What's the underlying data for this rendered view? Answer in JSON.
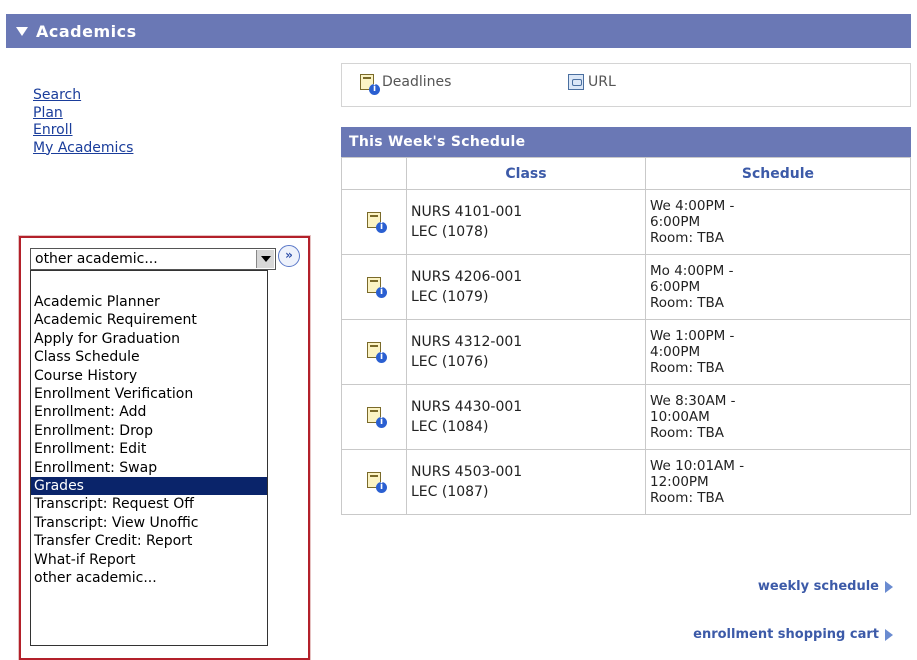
{
  "header": {
    "title": "Academics"
  },
  "links": [
    "Search",
    "Plan",
    "Enroll",
    "My Academics"
  ],
  "dropdown": {
    "selected": "other academic...",
    "go_symbol": "»",
    "options": [
      "Academic Planner",
      "Academic Requirement",
      "Apply for Graduation",
      "Class Schedule",
      "Course History",
      "Enrollment Verification",
      "Enrollment: Add",
      "Enrollment: Drop",
      "Enrollment: Edit",
      "Enrollment: Swap",
      "Grades",
      "Transcript: Request Off",
      "Transcript: View Unoffic",
      "Transfer Credit: Report",
      "What-if Report",
      "other academic..."
    ],
    "highlighted": "Grades"
  },
  "toolbar": {
    "deadlines_label": "Deadlines",
    "url_label": "URL"
  },
  "schedule": {
    "title": "This Week's Schedule",
    "col_class": "Class",
    "col_schedule": "Schedule",
    "rows": [
      {
        "class_code": "NURS 4101-001",
        "class_type": "LEC (1078)",
        "time": "We 4:00PM -",
        "time2": "6:00PM",
        "room": "Room:  TBA"
      },
      {
        "class_code": "NURS 4206-001",
        "class_type": "LEC (1079)",
        "time": "Mo 4:00PM -",
        "time2": "6:00PM",
        "room": "Room:  TBA"
      },
      {
        "class_code": "NURS 4312-001",
        "class_type": "LEC (1076)",
        "time": "We 1:00PM -",
        "time2": "4:00PM",
        "room": "Room:  TBA"
      },
      {
        "class_code": "NURS 4430-001",
        "class_type": "LEC (1084)",
        "time": "We 8:30AM -",
        "time2": "10:00AM",
        "room": "Room:  TBA"
      },
      {
        "class_code": "NURS 4503-001",
        "class_type": "LEC (1087)",
        "time": "We 10:01AM -",
        "time2": "12:00PM",
        "room": "Room:  TBA"
      }
    ]
  },
  "more_links": {
    "weekly": "weekly schedule",
    "cart": "enrollment shopping cart"
  },
  "colors": {
    "header_bg": "#6a78b5",
    "link": "#1a3d9b",
    "selection": "#0a246a",
    "frame": "#b3202a"
  }
}
